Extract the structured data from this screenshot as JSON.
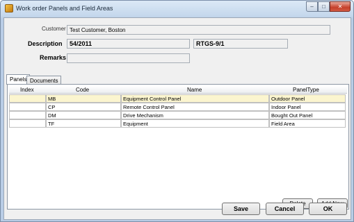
{
  "window": {
    "title": "Work order Panels and Field Areas",
    "controls": {
      "minimize": "–",
      "maximize": "□",
      "close": "✕"
    }
  },
  "form": {
    "customer_label": "Customer",
    "customer_value": "Test Customer, Boston",
    "description_label": "Description",
    "description_value": "54/2011",
    "reference_value": "RTGS-9/1",
    "remarks_label": "Remarks",
    "remarks_value": ""
  },
  "tabs": [
    {
      "label": "Panels",
      "active": true
    },
    {
      "label": "Documents",
      "active": false
    }
  ],
  "grid": {
    "columns": [
      "Index",
      "Code",
      "Name",
      "PanelType"
    ],
    "rows": [
      {
        "index": "",
        "code": "MB",
        "name": "Equipment Control Panel",
        "type": "Outdoor Panel",
        "selected": true
      },
      {
        "index": "",
        "code": "CP",
        "name": "Remote Control Panel",
        "type": "Indoor Panel",
        "selected": false
      },
      {
        "index": "",
        "code": "DM",
        "name": "Drive Mechanism",
        "type": "Bought Out Panel",
        "selected": false
      },
      {
        "index": "",
        "code": "TF",
        "name": "Equipment",
        "type": "Field Area",
        "selected": false
      }
    ]
  },
  "panel_buttons": {
    "delete": "Delete",
    "add_new": "Add New"
  },
  "footer_buttons": {
    "save": "Save",
    "cancel": "Cancel",
    "ok": "OK"
  }
}
